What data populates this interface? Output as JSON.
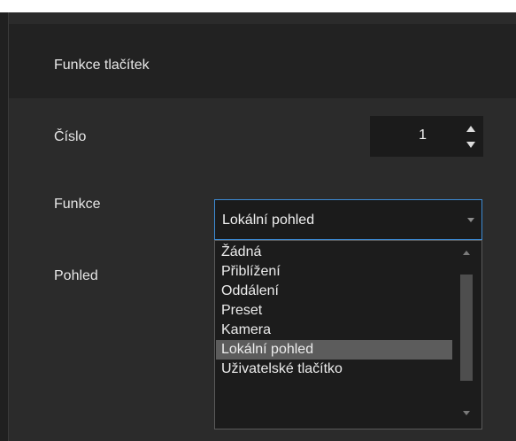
{
  "panel": {
    "title": "Funkce tlačítek"
  },
  "fields": {
    "number_label": "Číslo",
    "number_value": "1",
    "function_label": "Funkce",
    "function_value": "Lokální pohled",
    "view_label": "Pohled"
  },
  "dropdown": {
    "options": [
      "Žádná",
      "Přiblížení",
      "Oddálení",
      "Preset",
      "Kamera",
      "Lokální pohled",
      "Uživatelské tlačítko"
    ],
    "selected_index": 5
  },
  "colors": {
    "background": "#2b2b2b",
    "header": "#222222",
    "input_bg": "#1b1b1b",
    "focus_border": "#3d8bd4",
    "selected_option": "#5c5c5c"
  },
  "icons": {
    "spin_up": "chevron-up-icon",
    "spin_down": "chevron-down-icon",
    "select_arrow": "chevron-down-icon"
  }
}
